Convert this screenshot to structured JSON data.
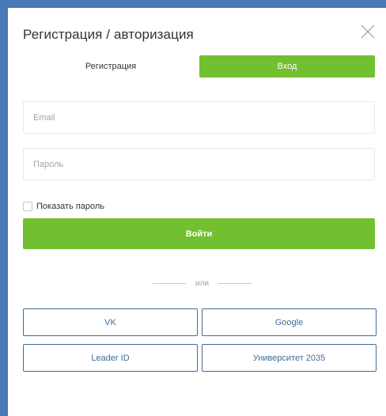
{
  "modal": {
    "title": "Регистрация / авторизация"
  },
  "tabs": [
    {
      "label": "Регистрация",
      "active": false
    },
    {
      "label": "Вход",
      "active": true
    }
  ],
  "form": {
    "email_placeholder": "Email",
    "email_value": "",
    "password_placeholder": "Пароль",
    "password_value": "",
    "show_password_label": "Показать пароль",
    "show_password_checked": false,
    "submit_label": "Войти"
  },
  "divider": {
    "text": "или"
  },
  "social": [
    {
      "label": "VK"
    },
    {
      "label": "Google"
    },
    {
      "label": "Leader ID"
    },
    {
      "label": "Университет 2035"
    }
  ],
  "colors": {
    "accent_green": "#72bf2f",
    "link_blue": "#3e6d9a",
    "backdrop": "#4a79b8"
  }
}
